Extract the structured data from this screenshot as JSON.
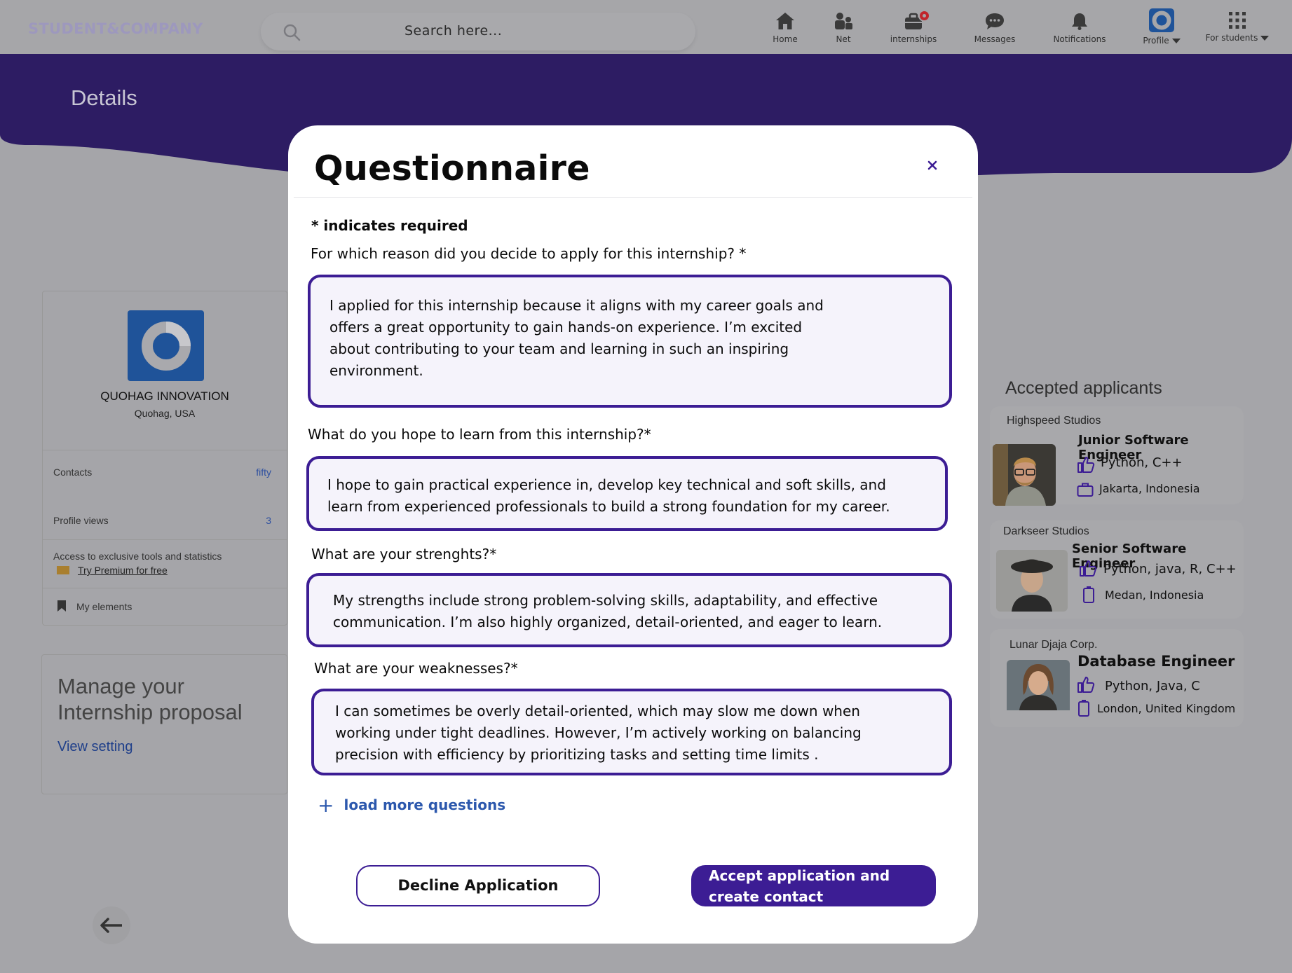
{
  "colors": {
    "brand_purple": "#3c1d94",
    "banner_purple": "#2d1c63",
    "link_blue": "#2c58ad",
    "overlay_gray": "#a5a5a9"
  },
  "topnav": {
    "brand": "STUDENT&COMPANY",
    "search_placeholder": "Search  here...",
    "items": [
      {
        "label": "Home",
        "icon": "home-icon"
      },
      {
        "label": "Net",
        "icon": "people-icon"
      },
      {
        "label": "internships",
        "icon": "briefcase-icon"
      },
      {
        "label": "Messages",
        "icon": "chat-icon"
      },
      {
        "label": "Notifications",
        "icon": "bell-icon"
      },
      {
        "label": "Profile",
        "icon": "profile-logo-icon"
      },
      {
        "label": "For students",
        "icon": "grid-icon"
      }
    ]
  },
  "banner": {
    "title": "Details"
  },
  "company": {
    "name": "QUOHAG INNOVATION",
    "location": "Quohag, USA",
    "contacts_label": "Contacts",
    "contacts_value": "fifty",
    "views_label": "Profile views",
    "views_value": "3",
    "premium_text": "Access to exclusive tools and statistics",
    "premium_link": "Try Premium for free",
    "my_elements": "My elements"
  },
  "manage": {
    "title": "Manage your Internship proposal",
    "link": "View setting"
  },
  "applicants": {
    "title": "Accepted applicants",
    "items": [
      {
        "company": "Highspeed Studios",
        "role": "Junior Software Engineer",
        "skills": "Python, C++",
        "location": "Jakarta, Indonesia"
      },
      {
        "company": "Darkseer Studios",
        "role": "Senior Software Engineer",
        "skills": "Python, java, R, C++",
        "location": "Medan, Indonesia"
      },
      {
        "company": "Lunar Djaja Corp.",
        "role": "Database Engineer",
        "skills": "Python, Java, C",
        "location": "London, United Kingdom"
      }
    ]
  },
  "modal": {
    "title": "Questionnaire",
    "required_note": "* indicates required",
    "questions": [
      {
        "question": "For which reason did you decide to apply for this internship? *",
        "answer_lines": [
          "I applied for this internship because it aligns with my career goals and",
          "offers a great opportunity to gain hands-on experience. I’m excited",
          "about contributing to your team and learning in such an inspiring",
          "environment."
        ]
      },
      {
        "question": "What do you hope to learn from this internship?*",
        "answer_lines": [
          "I hope to gain practical experience in, develop key technical and soft skills, and",
          "learn from experienced professionals to build a strong foundation for my career."
        ]
      },
      {
        "question": "What are your strenghts?*",
        "answer_lines": [
          "My strengths include strong problem-solving skills, adaptability, and effective",
          "communication. I’m also highly organized, detail-oriented, and eager to learn."
        ]
      },
      {
        "question": "What are your weaknesses?*",
        "answer_lines": [
          "I can sometimes be overly detail-oriented, which may slow me down when",
          "working under tight deadlines. However, I’m actively working on balancing",
          "precision with efficiency by prioritizing tasks and setting time limits ."
        ]
      }
    ],
    "load_more": "load more questions",
    "decline_label": "Decline Application",
    "accept_label_line1": "Accept application and",
    "accept_label_line2": "create contact"
  }
}
